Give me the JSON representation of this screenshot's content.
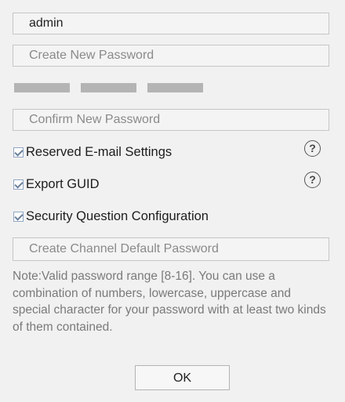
{
  "form": {
    "username_value": "admin",
    "new_password_placeholder": "Create New Password",
    "confirm_password_placeholder": "Confirm New Password",
    "channel_default_password_placeholder": "Create Channel Default Password"
  },
  "options": {
    "reserved_email_label": "Reserved E-mail Settings",
    "export_guid_label": "Export GUID",
    "security_question_label": "Security Question Configuration",
    "help_glyph": "?"
  },
  "note": {
    "text": "Note:Valid password range [8-16]. You can use a combination of numbers, lowercase, uppercase and special character for your password with at least two kinds of them contained."
  },
  "buttons": {
    "ok_label": "OK"
  },
  "icons": {
    "help": "question-circle-icon",
    "check": "checkmark-icon"
  },
  "colors": {
    "background": "#f1f1f1",
    "field_border": "#c6c6c6",
    "strength_bar": "#b4b4b4",
    "note_text": "#7a7a7a"
  }
}
